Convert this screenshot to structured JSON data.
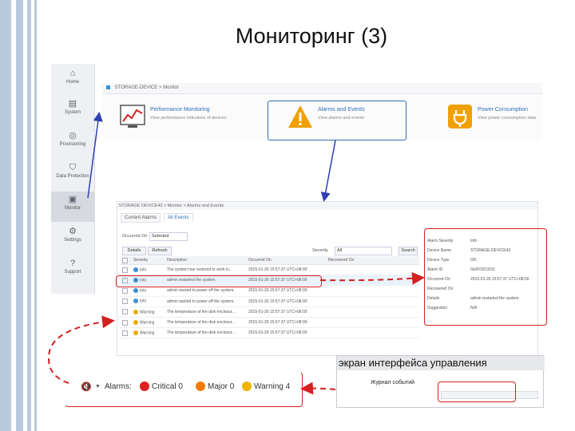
{
  "slide": {
    "title": "Мониторинг (3)"
  },
  "sidebar": {
    "items": [
      {
        "label": "Home",
        "icon": "home-icon",
        "glyph": "⌂"
      },
      {
        "label": "System",
        "icon": "server-icon",
        "glyph": "▤"
      },
      {
        "label": "Provisioning",
        "icon": "disk-icon",
        "glyph": "◎"
      },
      {
        "label": "Data Protection",
        "icon": "shield-icon",
        "glyph": "⛉"
      },
      {
        "label": "Monitor",
        "icon": "monitor-icon",
        "glyph": "▣"
      },
      {
        "label": "Settings",
        "icon": "gear-icon",
        "glyph": "⚙"
      },
      {
        "label": "Support",
        "icon": "help-icon",
        "glyph": "?"
      }
    ]
  },
  "monitor_page": {
    "breadcrumb_device": "STORAGE-DEVICE",
    "breadcrumb_sep": ">",
    "breadcrumb_page": "Monitor",
    "cards": [
      {
        "title": "Performance Monitoring",
        "desc": "View performance indicators of devices",
        "icon": "chart-icon"
      },
      {
        "title": "Alarms and Events",
        "desc": "View alarms and events",
        "icon": "warning-icon"
      },
      {
        "title": "Power Consumption",
        "desc": "View power consumption data",
        "icon": "plug-icon"
      }
    ]
  },
  "events_page": {
    "breadcrumb": "STORAGE DEVICE43 > Monitor > Alarms and Events",
    "tabs": [
      "Current Alarms",
      "All Events"
    ],
    "active_tab": "All Events",
    "filter": {
      "occurred_label": "Occurred On",
      "occurred_value": "Selected",
      "severity_label": "Severity",
      "severity_value": "All",
      "search_label": "Search"
    },
    "toolbar": {
      "details_label": "Details",
      "refresh_label": "Refresh"
    },
    "columns": [
      "Severity",
      "Description",
      "Occurred On",
      "Recovered On"
    ],
    "rows": [
      {
        "severity": "Info",
        "level": "info",
        "description": "The system has restored to work in...",
        "occurred": "2015-01-26 15:57:37 UTC+08:00",
        "checked": false
      },
      {
        "severity": "Info",
        "level": "info",
        "description": "admin restarted the system.",
        "occurred": "2015-01-26 15:57:37 UTC+08:00",
        "checked": true
      },
      {
        "severity": "Info",
        "level": "info",
        "description": "admin started to power off the system.",
        "occurred": "2015-01-26 15:57:37 UTC+08:00",
        "checked": false
      },
      {
        "severity": "Info",
        "level": "info",
        "description": "admin started to power off the system.",
        "occurred": "2015-01-26 15:57:37 UTC+08:00",
        "checked": false
      },
      {
        "severity": "Warning",
        "level": "warn",
        "description": "The temperature of the disk enclosur...",
        "occurred": "2015-01-26 15:57:37 UTC+08:00",
        "checked": false
      },
      {
        "severity": "Warning",
        "level": "warn",
        "description": "The temperature of the disk enclosur...",
        "occurred": "2015-01-26 15:57:37 UTC+08:00",
        "checked": false
      },
      {
        "severity": "Warning",
        "level": "warn",
        "description": "The temperature of the disk enclosur...",
        "occurred": "2015-01-26 15:57:37 UTC+08:00",
        "checked": false
      }
    ],
    "details": [
      {
        "label": "Alarm Severity",
        "value": "Info"
      },
      {
        "label": "Device Name",
        "value": "STORAGE-DEVICE43"
      },
      {
        "label": "Device Type",
        "value": "OD"
      },
      {
        "label": "Alarm ID",
        "value": "0x0F03C0011"
      },
      {
        "label": "Occurred On",
        "value": "2015-01-26 15:57:37 UTC+08:00"
      },
      {
        "label": "Recovered On",
        "value": ""
      },
      {
        "label": "Details",
        "value": "admin restarted the system."
      },
      {
        "label": "Suggestion",
        "value": "N/A"
      }
    ]
  },
  "alarm_bar": {
    "alarms_label": "Alarms:",
    "critical": "Critical 0",
    "major": "Major 0",
    "warning": "Warning 4",
    "colors": {
      "critical": "#e02020",
      "major": "#f07a00",
      "warning": "#f0b400"
    }
  },
  "mgmt_screen": {
    "caption": "экран интерфейса управления",
    "log_label": "Журнал событий"
  },
  "colors": {
    "annotation_red": "#d32020",
    "annotation_blue": "#2f3fb3",
    "accent": "#3b8fd6"
  }
}
